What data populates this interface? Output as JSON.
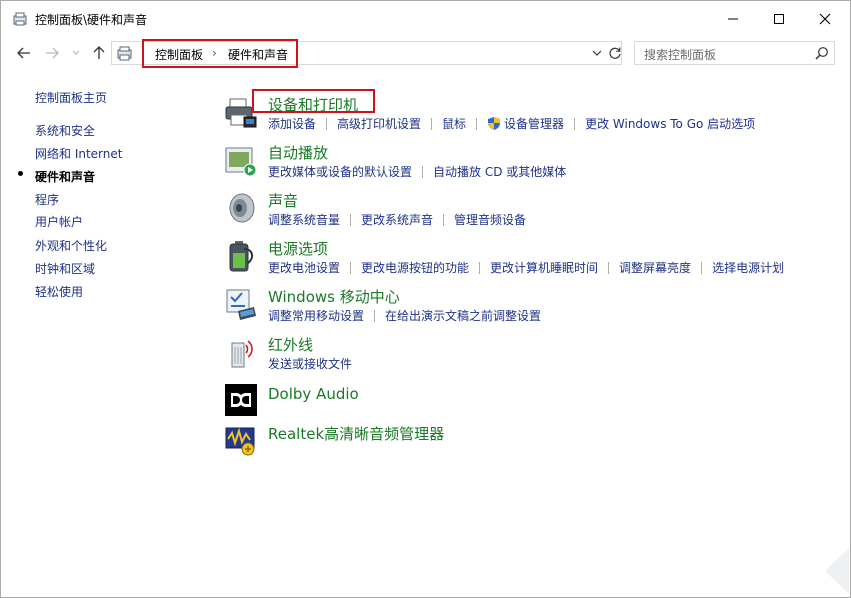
{
  "window": {
    "title": "控制面板\\硬件和声音"
  },
  "nav": {
    "breadcrumb": [
      "控制面板",
      "硬件和声音"
    ],
    "breadcrumb_separator": "›",
    "search_placeholder": "搜索控制面板"
  },
  "sidebar": {
    "items": [
      {
        "label": "控制面板主页",
        "current": false
      },
      {
        "label": "系统和安全",
        "current": false
      },
      {
        "label": "网络和 Internet",
        "current": false
      },
      {
        "label": "硬件和声音",
        "current": true
      },
      {
        "label": "程序",
        "current": false
      },
      {
        "label": "用户帐户",
        "current": false
      },
      {
        "label": "外观和个性化",
        "current": false
      },
      {
        "label": "时钟和区域",
        "current": false
      },
      {
        "label": "轻松使用",
        "current": false
      }
    ]
  },
  "categories": [
    {
      "title": "设备和打印机",
      "icon": "printer-icon",
      "links": [
        "添加设备",
        "高级打印机设置",
        "鼠标",
        "设备管理器",
        "更改 Windows To Go 启动选项"
      ]
    },
    {
      "title": "自动播放",
      "icon": "autoplay-icon",
      "links": [
        "更改媒体或设备的默认设置",
        "自动播放 CD 或其他媒体"
      ]
    },
    {
      "title": "声音",
      "icon": "speaker-icon",
      "links": [
        "调整系统音量",
        "更改系统声音",
        "管理音频设备"
      ]
    },
    {
      "title": "电源选项",
      "icon": "battery-icon",
      "links": [
        "更改电池设置",
        "更改电源按钮的功能",
        "更改计算机睡眠时间",
        "调整屏幕亮度",
        "选择电源计划"
      ]
    },
    {
      "title": "Windows 移动中心",
      "icon": "mobility-center-icon",
      "links": [
        "调整常用移动设置",
        "在给出演示文稿之前调整设置"
      ]
    },
    {
      "title": "红外线",
      "icon": "infrared-icon",
      "links": [
        "发送或接收文件"
      ]
    },
    {
      "title": "Dolby Audio",
      "icon": "dolby-icon",
      "links": []
    },
    {
      "title": "Realtek高清晰音频管理器",
      "icon": "realtek-icon",
      "links": []
    }
  ],
  "colors": {
    "category_title": "#1a7a26",
    "link": "#1e3287",
    "highlight_box": "#d0121d"
  }
}
